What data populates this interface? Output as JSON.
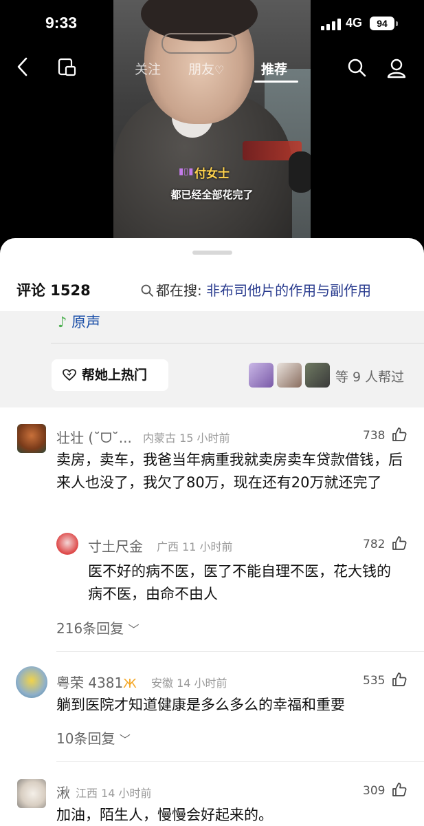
{
  "status_bar": {
    "time": "9:33",
    "network": "4G",
    "battery": "94"
  },
  "nav": {
    "tabs": [
      {
        "label": "关注",
        "active": false
      },
      {
        "label": "朋友",
        "active": false
      },
      {
        "label": "推荐",
        "active": true
      }
    ]
  },
  "video": {
    "subtitle_name": "付女士",
    "subtitle_line": "都已经全部花完了"
  },
  "sheet": {
    "comment_count": "评论 1528",
    "hot_search_prefix": "都在搜:",
    "hot_search_query": "非布司他片的作用与副作用",
    "music_label": "原声",
    "boost_button": "帮她上热门",
    "helpers_text": "等 9 人帮过"
  },
  "comments": [
    {
      "name": "壮壮 (˘ᗜ˘...",
      "region": "内蒙古",
      "time": "15 小时前",
      "likes": "738",
      "text": "卖房，卖车，我爸当年病重我就卖房卖车贷款借钱，后来人也没了，我欠了80万，现在还有20万就还完了",
      "reply": {
        "name": "寸土尺金",
        "region": "广西",
        "time": "11 小时前",
        "likes": "782",
        "text": "医不好的病不医，医了不能自理不医，花大钱的病不医，由命不由人"
      },
      "replies_label": "216条回复"
    },
    {
      "name": "粤荣 4381",
      "region": "安徽",
      "time": "14 小时前",
      "likes": "535",
      "text": "躺到医院才知道健康是多么多么的幸福和重要",
      "replies_label": "10条回复"
    },
    {
      "name": "湫",
      "region": "江西",
      "time": "14 小时前",
      "likes": "309",
      "text": "加油，陌生人，慢慢会好起来的。"
    }
  ],
  "icons": {
    "back": "chevron-left-icon",
    "mini_window": "mini-window-icon",
    "search": "search-icon",
    "profile": "profile-icon",
    "like": "thumbs-up-icon",
    "boost": "heart-icon",
    "music": "music-note-icon",
    "expand": "chevron-down-icon"
  },
  "colors": {
    "link_blue": "#2a3c8f",
    "music_blue": "#1b4fa8",
    "subtitle_yellow": "#ffd34d",
    "sheet_gray": "#f2f2f2"
  }
}
